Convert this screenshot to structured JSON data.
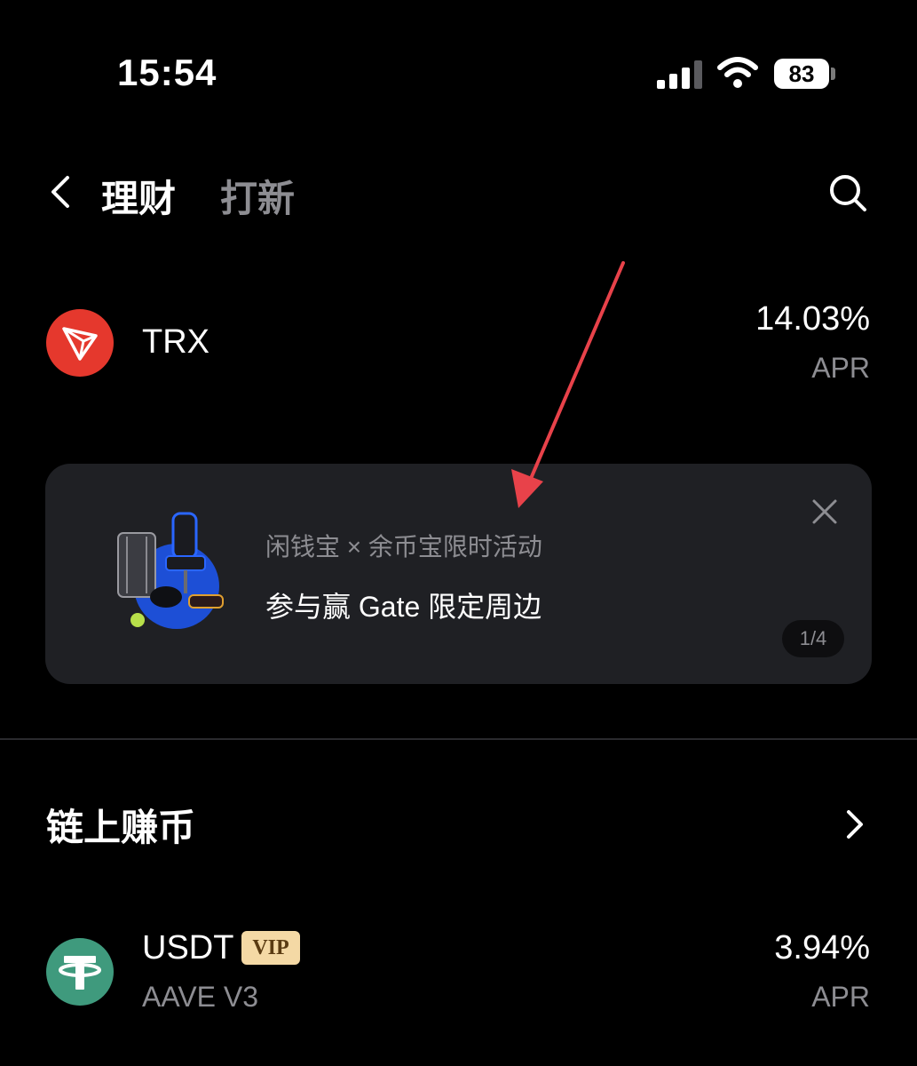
{
  "status_bar": {
    "time": "15:54",
    "battery_level": "83",
    "icons": [
      "signal-icon",
      "wifi-icon",
      "battery-icon"
    ]
  },
  "nav": {
    "back_icon": "chevron-left-icon",
    "tabs": [
      {
        "label": "理财",
        "active": true
      },
      {
        "label": "打新",
        "active": false
      }
    ],
    "search_icon": "search-icon"
  },
  "featured": {
    "name": "TRX",
    "rate": "14.03%",
    "rate_label": "APR",
    "logo_color": "#e5382d"
  },
  "promo": {
    "subtitle": "闲钱宝 × 余币宝限时活动",
    "title": "参与赢 Gate 限定周边",
    "page_indicator": "1/4"
  },
  "onchain_section": {
    "title": "链上赚币",
    "items": [
      {
        "name": "USDT",
        "badge": "VIP",
        "protocol": "AAVE V3",
        "rate": "3.94%",
        "rate_label": "APR",
        "logo_color": "#3f9a7d"
      }
    ]
  },
  "colors": {
    "background": "#000000",
    "card": "#1f2024",
    "muted_text": "#8d8d92",
    "annotation_arrow": "#e8424a"
  }
}
